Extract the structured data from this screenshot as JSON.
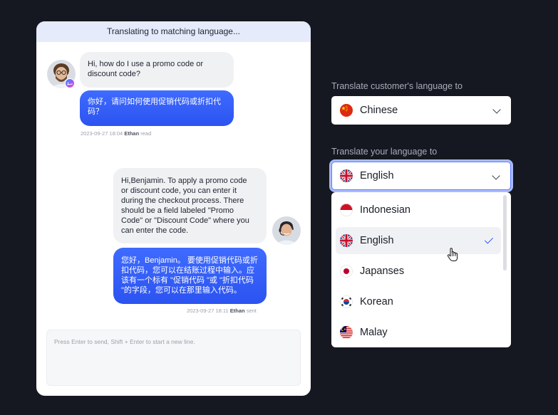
{
  "chat": {
    "header": "Translating to matching language...",
    "messages": [
      {
        "text": "Hi, how do I use a promo code or\ndiscount code?"
      },
      {
        "text": "你好，请问如何使用促销代码或折扣代\n码？"
      },
      {
        "text": "Hi,Benjamin. To apply a promo code\nor discount code, you can enter it\nduring the checkout process. There\nshould be a field labeled \"Promo\nCode\" or \"Discount Code\" where you\ncan enter the code."
      },
      {
        "text": "您好，Benjamin。 要使用促销代码或折\n扣代码，您可以在结账过程中输入。应\n该有一个标有 \"促销代码 \"或 \"折扣代码\n\"的字段，您可以在那里输入代码。"
      }
    ],
    "meta1": {
      "time": "2023-09-27 18:04",
      "agent": "Ethan",
      "status": "read"
    },
    "meta2": {
      "time": "2023-09-27 18:11",
      "agent": "Ethan",
      "status": "sent"
    },
    "input_placeholder": "Press Enter to send,  Shift + Enter to start a new line."
  },
  "translate": {
    "customer_label": "Translate customer's language to",
    "customer_value": "Chinese",
    "customer_flag": "china-flag-icon",
    "your_label": "Translate your language to",
    "your_value": "English",
    "your_flag": "uk-flag-icon",
    "options": [
      {
        "label": "Indonesian",
        "flag": "indonesia-flag-icon"
      },
      {
        "label": "English",
        "flag": "uk-flag-icon",
        "selected": true
      },
      {
        "label": "Japanses",
        "flag": "japan-flag-icon"
      },
      {
        "label": "Korean",
        "flag": "korea-flag-icon"
      },
      {
        "label": "Malay",
        "flag": "malaysia-flag-icon"
      }
    ]
  },
  "colors": {
    "background": "#161821",
    "bubble_blue": "#2b53f0",
    "header_tint": "#e6ebfb",
    "focus_ring": "#a9bbff",
    "check": "#3a5bff"
  }
}
